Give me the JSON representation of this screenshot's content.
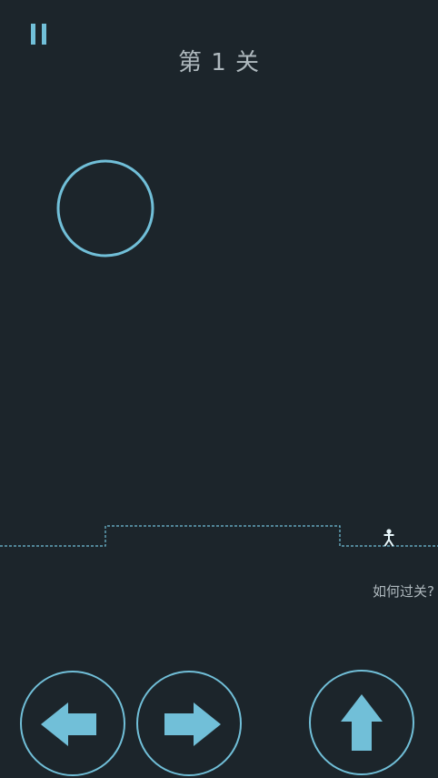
{
  "game": {
    "level_title": "第 1 关",
    "hint_label": "如何过关?"
  },
  "colors": {
    "background": "#1c252b",
    "accent": "#71bfd8",
    "text": "#aeb8bd"
  },
  "icons": {
    "pause": "pause-icon",
    "left": "left-arrow-icon",
    "right": "right-arrow-icon",
    "jump": "up-arrow-icon",
    "ring": "ring-target",
    "player": "stick-figure"
  }
}
